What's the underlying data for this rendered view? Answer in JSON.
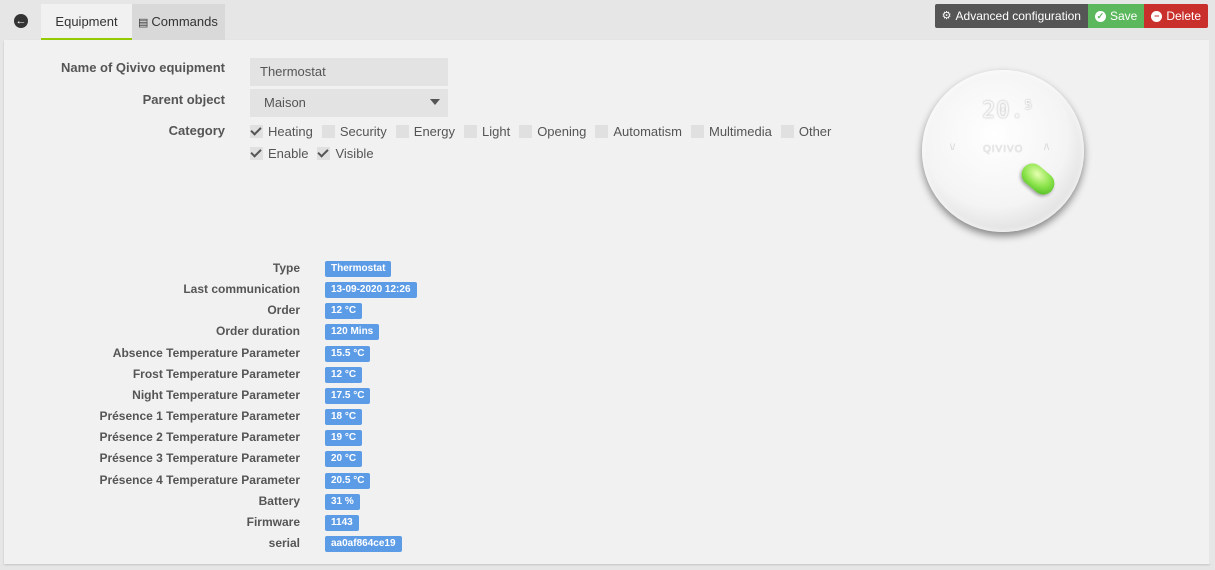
{
  "tabs": {
    "equipment": "Equipment",
    "commands": "Commands"
  },
  "actions": {
    "advanced": "Advanced configuration",
    "save": "Save",
    "delete": "Delete"
  },
  "form": {
    "name_label": "Name of Qivivo equipment",
    "name_value": "Thermostat",
    "parent_label": "Parent object",
    "parent_value": "Maison",
    "category_label": "Category",
    "categories": [
      {
        "label": "Heating",
        "checked": true
      },
      {
        "label": "Security",
        "checked": false
      },
      {
        "label": "Energy",
        "checked": false
      },
      {
        "label": "Light",
        "checked": false
      },
      {
        "label": "Opening",
        "checked": false
      },
      {
        "label": "Automatism",
        "checked": false
      },
      {
        "label": "Multimedia",
        "checked": false
      },
      {
        "label": "Other",
        "checked": false
      }
    ],
    "enable_label": "Enable",
    "enable_checked": true,
    "visible_label": "Visible",
    "visible_checked": true
  },
  "info": [
    {
      "label": "Type",
      "value": "Thermostat"
    },
    {
      "label": "Last communication",
      "value": "13-09-2020 12:26"
    },
    {
      "label": "Order",
      "value": "12 °C"
    },
    {
      "label": "Order duration",
      "value": "120 Mins"
    },
    {
      "label": "Absence Temperature Parameter",
      "value": "15.5 °C"
    },
    {
      "label": "Frost Temperature Parameter",
      "value": "12 °C"
    },
    {
      "label": "Night Temperature Parameter",
      "value": "17.5 °C"
    },
    {
      "label": "Présence 1 Temperature Parameter",
      "value": "18 °C"
    },
    {
      "label": "Présence 2 Temperature Parameter",
      "value": "19 °C"
    },
    {
      "label": "Présence 3 Temperature Parameter",
      "value": "20 °C"
    },
    {
      "label": "Présence 4 Temperature Parameter",
      "value": "20.5 °C"
    },
    {
      "label": "Battery",
      "value": "31 %"
    },
    {
      "label": "Firmware",
      "value": "1143"
    },
    {
      "label": "serial",
      "value": "aa0af864ce19"
    }
  ],
  "device": {
    "display_main": "20.",
    "display_sup": "5",
    "brand": "QIVIVO"
  },
  "colors": {
    "accent": "#94ca02",
    "badge": "#5c9ce6",
    "save": "#5cb85c",
    "delete": "#c9302c",
    "dark": "#555555"
  },
  "icons": {
    "back": "arrow-left-circle-icon",
    "commands": "list-icon",
    "advanced": "cogs-icon",
    "save": "check-circle-icon",
    "delete": "minus-circle-icon"
  }
}
